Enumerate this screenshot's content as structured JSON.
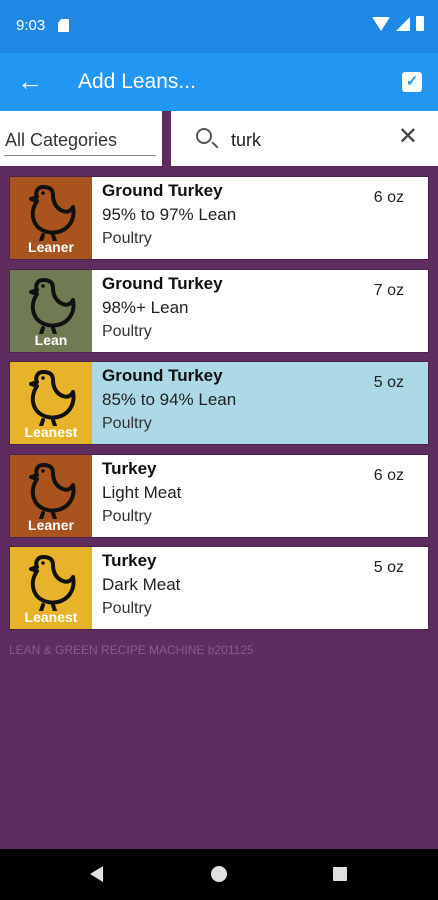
{
  "status_bar": {
    "time": "9:03"
  },
  "app_bar": {
    "back_icon": "back-arrow-icon",
    "title": "Add Leans...",
    "action_icon": "check-box-icon"
  },
  "filter": {
    "category": "All Categories"
  },
  "search": {
    "value": "turk",
    "icon": "search-icon",
    "clear_icon": "close-icon"
  },
  "items": [
    {
      "name": "Ground Turkey",
      "desc": "95% to 97% Lean",
      "category": "Poultry",
      "qty": "6 oz",
      "badge": "Leaner",
      "badge_color": "#a9531e",
      "selected": false
    },
    {
      "name": "Ground Turkey",
      "desc": "98%+ Lean",
      "category": "Poultry",
      "qty": "7 oz",
      "badge": "Lean",
      "badge_color": "#707b54",
      "selected": false
    },
    {
      "name": "Ground Turkey",
      "desc": "85% to 94% Lean",
      "category": "Poultry",
      "qty": "5 oz",
      "badge": "Leanest",
      "badge_color": "#e6b32a",
      "selected": true
    },
    {
      "name": "Turkey",
      "desc": "Light Meat",
      "category": "Poultry",
      "qty": "6 oz",
      "badge": "Leaner",
      "badge_color": "#a9531e",
      "selected": false
    },
    {
      "name": "Turkey",
      "desc": "Dark Meat",
      "category": "Poultry",
      "qty": "5 oz",
      "badge": "Leanest",
      "badge_color": "#e6b32a",
      "selected": false
    }
  ],
  "footer": {
    "text": "LEAN & GREEN RECIPE MACHINE b201125"
  },
  "colors": {
    "status_bar": "#1e88e5",
    "app_bar": "#2196f3",
    "background": "#5e2c5e",
    "selected_row": "#add8e6"
  }
}
